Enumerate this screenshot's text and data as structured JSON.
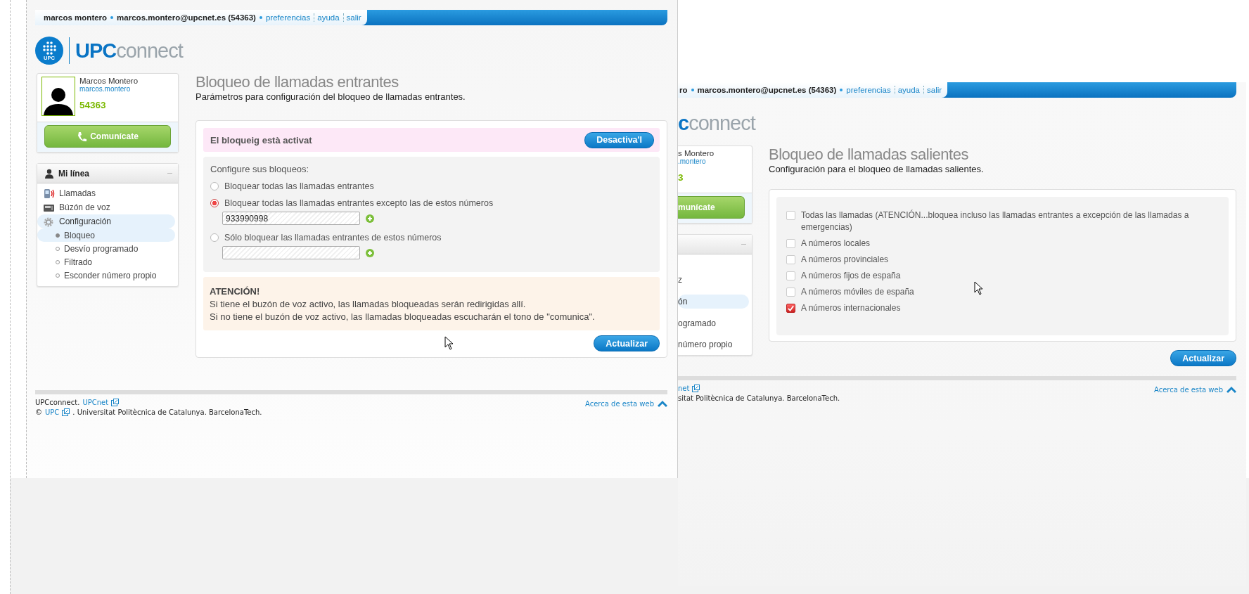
{
  "left_window": {
    "header": {
      "user": "marcos montero",
      "email": "marcos.montero@upcnet.es (54363)",
      "links": [
        "preferencias",
        "ayuda",
        "salir"
      ]
    },
    "logo": {
      "badge": "UPC",
      "brand": "**UPC**connect"
    },
    "profile": {
      "name": "Marcos Montero",
      "username": "marcos.montero",
      "extension": "54363",
      "call_button": "Comunícate"
    },
    "nav": {
      "title": "Mi línea",
      "items": [
        {
          "label": "Llamadas",
          "selected": false
        },
        {
          "label": "Búzón de voz",
          "selected": false
        },
        {
          "label": "Configuración",
          "selected": true,
          "expanded": true,
          "children": [
            {
              "label": "Bloqueo",
              "selected": true
            },
            {
              "label": "Desvío programado",
              "selected": false
            },
            {
              "label": "Filtrado",
              "selected": false
            },
            {
              "label": "Esconder número propio",
              "selected": false
            }
          ]
        }
      ]
    },
    "page": {
      "title": "Bloqueo de llamadas entrantes",
      "subtitle": "Parámetros para configuración del bloqueo de llamadas entrantes."
    },
    "status": {
      "text": "El bloqueig està activat",
      "button": "Desactiva'l"
    },
    "options": {
      "heading": "Configure sus bloqueos:",
      "items": [
        {
          "kind": "plain",
          "label": "Bloquear todas las llamadas entrantes",
          "selected": false
        },
        {
          "kind": "numbers",
          "label": "Bloquear todas las llamadas entrantes excepto las de estos números",
          "selected": true,
          "value": "933990998"
        },
        {
          "kind": "numbers",
          "label": "Sólo bloquear las llamadas entrantes de estos números",
          "selected": false
        }
      ]
    },
    "warning": {
      "title": "ATENCIÓN!",
      "lines": [
        "Si tiene el buzón de voz activo, las llamadas bloqueadas serán redirigidas allí.",
        "Si no tiene el buzón de voz activo, las llamadas bloqueadas escucharán el tono de \"comunica\"."
      ]
    },
    "submit": "Actualizar",
    "footer": {
      "lines": [
        [
          {
            "kind": "text",
            "text": "UPCconnect."
          },
          {
            "kind": "link",
            "text": "UPCnet"
          }
        ],
        [
          {
            "kind": "text",
            "text": "©"
          },
          {
            "kind": "link",
            "text": "UPC"
          },
          {
            "kind": "text",
            "text": ". Universitat Politècnica de Catalunya. BarcelonaTech."
          }
        ]
      ],
      "about_link": "Acerca de esta web"
    }
  },
  "right_window": {
    "header": {
      "user": "ro",
      "email": "marcos.montero@upcnet.es (54363)",
      "links": [
        "preferencias",
        "ayuda",
        "salir"
      ]
    },
    "logo": {
      "brand": "**c**connect"
    },
    "profile": {
      "name": "s Montero",
      "username": ".montero",
      "extension": "3",
      "call_button": "munícate"
    },
    "nav": {
      "items": [
        {
          "label": "z",
          "selected": false
        },
        {
          "label": "ón",
          "selected": true,
          "expanded": true,
          "children": [
            {
              "label": "ogramado",
              "selected": false
            },
            {
              "label": "número propio",
              "selected": false
            }
          ]
        }
      ]
    },
    "page": {
      "title": "Bloqueo de llamadas salientes",
      "subtitle": "Configuración para el bloqueo de llamadas salientes."
    },
    "checks": [
      {
        "label": "Todas las llamadas (ATENCIÓN...bloquea incluso las llamadas entrantes a excepción de las llamadas a emergencias)",
        "checked": false
      },
      {
        "label": "A números locales",
        "checked": false
      },
      {
        "label": "A números provinciales",
        "checked": false
      },
      {
        "label": "A números fijos de españa",
        "checked": false
      },
      {
        "label": "A números móviles de españa",
        "checked": false
      },
      {
        "label": "A números internacionales",
        "checked": true
      }
    ],
    "submit": "Actualizar",
    "footer": {
      "lines": [
        [
          {
            "kind": "link",
            "text": "net"
          }
        ],
        [
          {
            "kind": "text",
            "text": "sitat Politècnica de Catalunya. BarcelonaTech."
          }
        ]
      ],
      "about_link": "Acerca de esta web"
    }
  }
}
